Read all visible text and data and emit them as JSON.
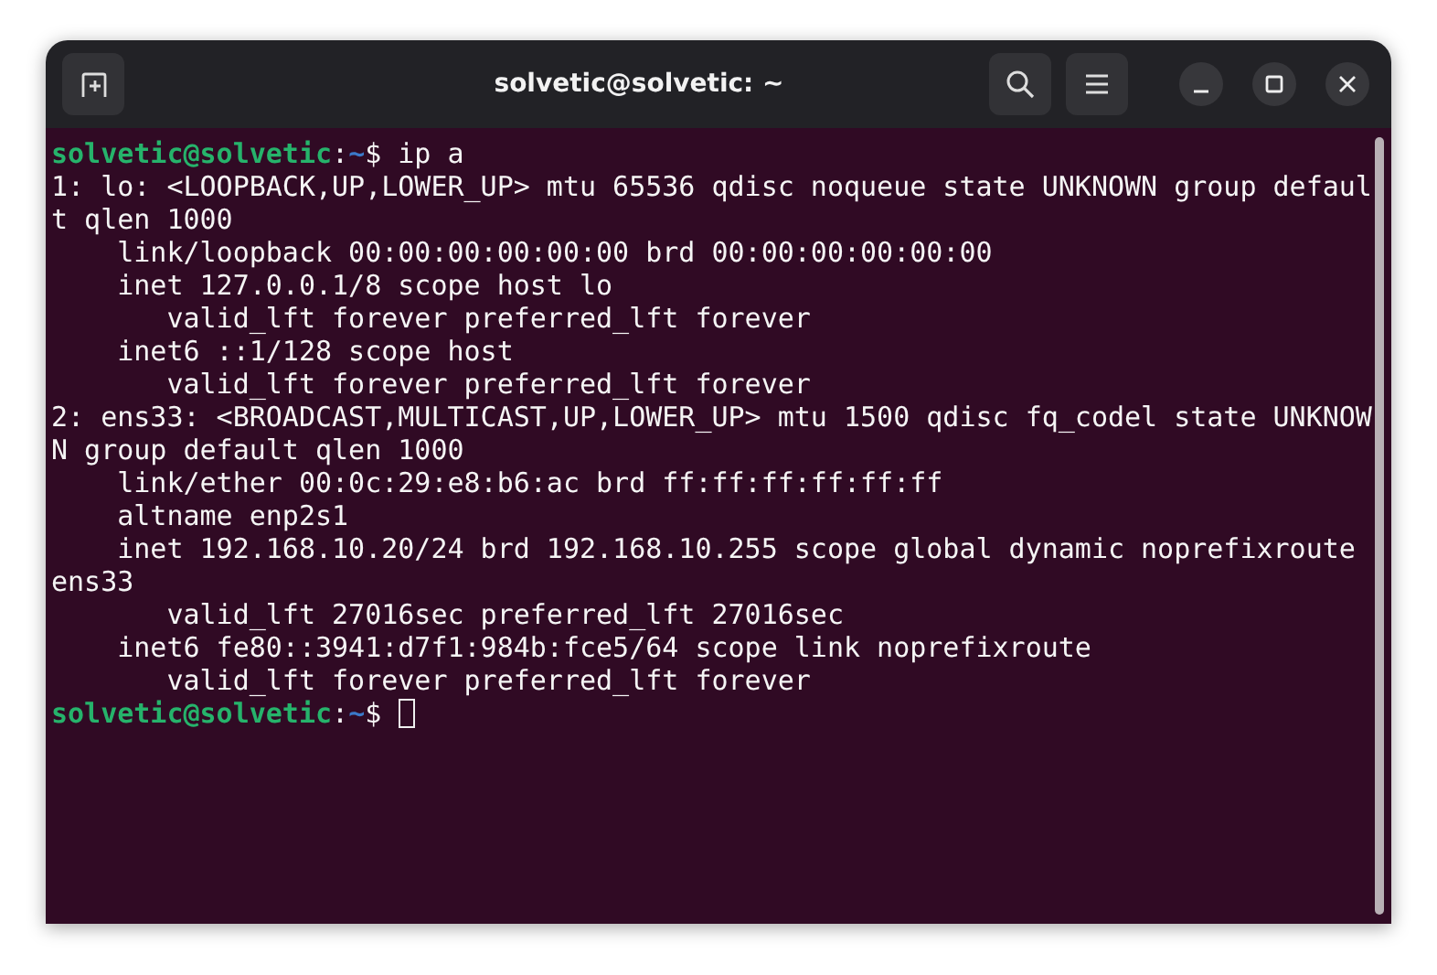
{
  "window": {
    "title": "solvetic@solvetic: ~"
  },
  "terminal": {
    "lines": [
      {
        "kind": "prompt",
        "user": "solvetic@solvetic",
        "separator": ":",
        "path": "~",
        "symbol": "$",
        "command": "ip a",
        "cursor": false
      },
      {
        "kind": "output",
        "text": "1: lo: <LOOPBACK,UP,LOWER_UP> mtu 65536 qdisc noqueue state UNKNOWN group defaul"
      },
      {
        "kind": "output",
        "text": "t qlen 1000"
      },
      {
        "kind": "output",
        "text": "    link/loopback 00:00:00:00:00:00 brd 00:00:00:00:00:00"
      },
      {
        "kind": "output",
        "text": "    inet 127.0.0.1/8 scope host lo"
      },
      {
        "kind": "output",
        "text": "       valid_lft forever preferred_lft forever"
      },
      {
        "kind": "output",
        "text": "    inet6 ::1/128 scope host"
      },
      {
        "kind": "output",
        "text": "       valid_lft forever preferred_lft forever"
      },
      {
        "kind": "output",
        "text": "2: ens33: <BROADCAST,MULTICAST,UP,LOWER_UP> mtu 1500 qdisc fq_codel state UNKNOW"
      },
      {
        "kind": "output",
        "text": "N group default qlen 1000"
      },
      {
        "kind": "output",
        "text": "    link/ether 00:0c:29:e8:b6:ac brd ff:ff:ff:ff:ff:ff"
      },
      {
        "kind": "output",
        "text": "    altname enp2s1"
      },
      {
        "kind": "output",
        "text": "    inet 192.168.10.20/24 brd 192.168.10.255 scope global dynamic noprefixroute"
      },
      {
        "kind": "output",
        "text": "ens33"
      },
      {
        "kind": "output",
        "text": "       valid_lft 27016sec preferred_lft 27016sec"
      },
      {
        "kind": "output",
        "text": "    inet6 fe80::3941:d7f1:984b:fce5/64 scope link noprefixroute"
      },
      {
        "kind": "output",
        "text": "       valid_lft forever preferred_lft forever"
      },
      {
        "kind": "prompt",
        "user": "solvetic@solvetic",
        "separator": ":",
        "path": "~",
        "symbol": "$",
        "cursor": true
      }
    ]
  }
}
